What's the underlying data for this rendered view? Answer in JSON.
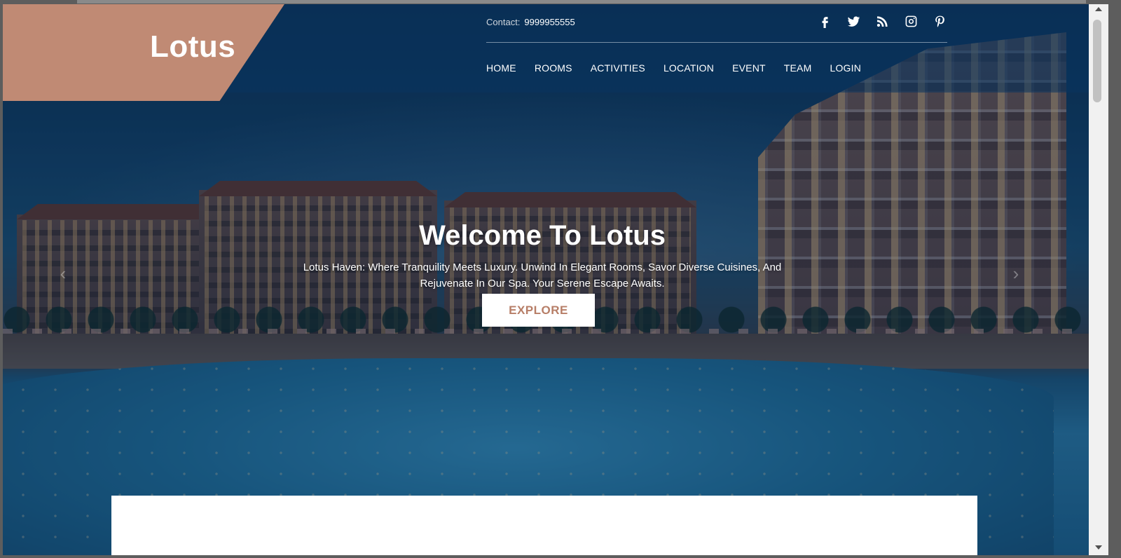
{
  "brand": {
    "logo": "Lotus"
  },
  "contact": {
    "label": "Contact:",
    "number": "9999955555"
  },
  "social": [
    {
      "name": "facebook-icon"
    },
    {
      "name": "twitter-icon"
    },
    {
      "name": "rss-icon"
    },
    {
      "name": "instagram-icon"
    },
    {
      "name": "pinterest-icon"
    }
  ],
  "nav": {
    "items": [
      "HOME",
      "ROOMS",
      "ACTIVITIES",
      "LOCATION",
      "EVENT",
      "TEAM",
      "LOGIN"
    ]
  },
  "hero": {
    "title": "Welcome To Lotus",
    "subtitle": "Lotus Haven: Where Tranquility Meets Luxury. Unwind In Elegant Rooms, Savor Diverse Cuisines, And Rejuvenate In Our Spa. Your Serene Escape Awaits.",
    "cta": "EXPLORE",
    "prev_arrow": "‹",
    "next_arrow": "›"
  },
  "colors": {
    "accent": "#c08a74",
    "cta_text": "#b77e67",
    "header_overlay": "#0a3460"
  }
}
